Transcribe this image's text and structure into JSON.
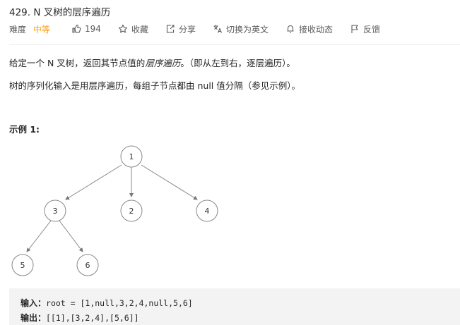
{
  "problem": {
    "title": "429. N 叉树的层序遍历"
  },
  "meta": {
    "difficulty_label": "难度",
    "difficulty_value": "中等",
    "likes": "194",
    "favorite_label": "收藏",
    "share_label": "分享",
    "translate_label": "切换为英文",
    "notify_label": "接收动态",
    "feedback_label": "反馈",
    "difficulty_color": "#ffa116"
  },
  "description": {
    "p1_prefix": "给定一个 N 叉树，返回其节点值的",
    "p1_em": "层序遍历",
    "p1_suffix": "。（即从左到右，逐层遍历）。",
    "p2": "树的序列化输入是用层序遍历，每组子节点都由 null 值分隔（参见示例）。"
  },
  "example": {
    "title": "示例 1:",
    "tree_nodes": [
      "1",
      "3",
      "2",
      "4",
      "5",
      "6"
    ],
    "input_label": "输入：",
    "input_value": "root = [1,null,3,2,4,null,5,6]",
    "output_label": "输出：",
    "output_value": "[[1],[3,2,4],[5,6]]"
  }
}
